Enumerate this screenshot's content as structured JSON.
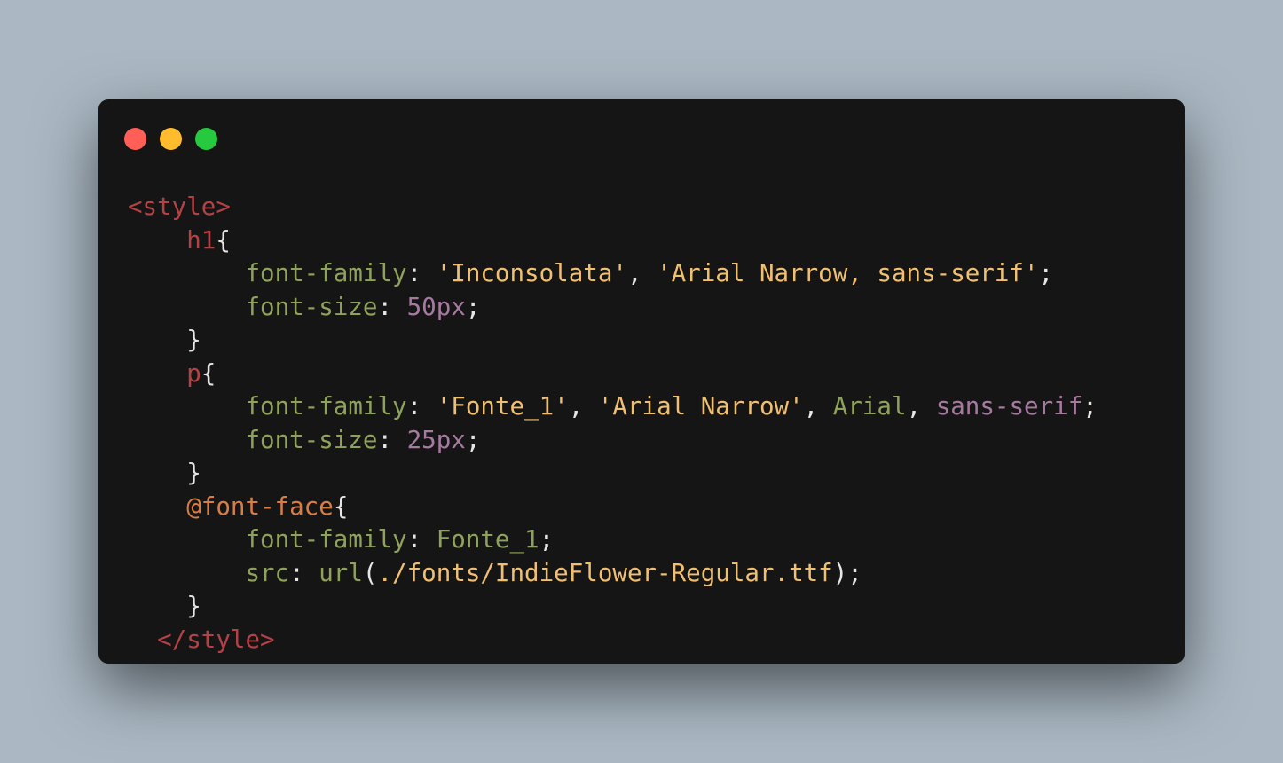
{
  "window": {
    "controls": {
      "close_color": "#ff5f56",
      "minimize_color": "#ffbd2e",
      "maximize_color": "#27c93f"
    }
  },
  "code": {
    "style_open": "<style>",
    "h1_selector": "h1",
    "open_brace": "{",
    "close_brace": "}",
    "colon": ":",
    "semicolon": ";",
    "comma": ",",
    "font_family_prop": "font-family",
    "font_size_prop": "font-size",
    "src_prop": "src",
    "h1_font_1": "'Inconsolata'",
    "h1_font_2": "'Arial Narrow, sans-serif'",
    "h1_size": "50px",
    "p_selector": "p",
    "p_font_1": "'Fonte_1'",
    "p_font_2": "'Arial Narrow'",
    "p_font_3": "Arial",
    "p_font_4": "sans-serif",
    "p_size": "25px",
    "fontface_rule": "@font-face",
    "fontface_family": "Fonte_1",
    "url_fn": "url",
    "paren_open": "(",
    "paren_close": ")",
    "url_path": "./fonts/IndieFlower-Regular.ttf",
    "style_close": "</style>"
  }
}
